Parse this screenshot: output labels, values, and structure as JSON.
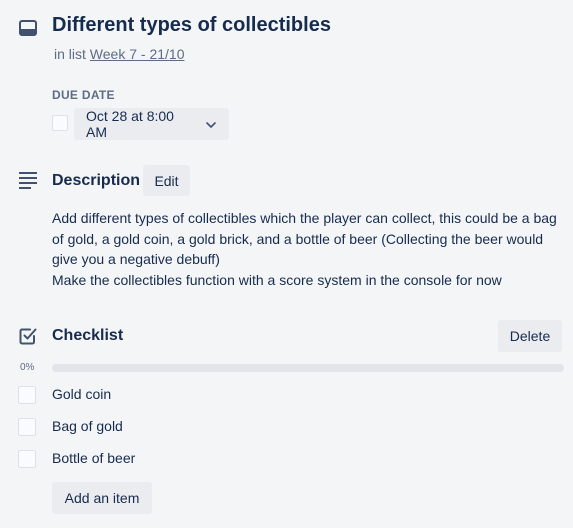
{
  "card": {
    "title": "Different types of collectibles",
    "in_list_prefix": "in list",
    "list_name": "Week 7 - 21/10",
    "icon": "card-icon"
  },
  "due_date": {
    "label": "DUE DATE",
    "value": "Oct 28 at 8:00 AM",
    "completed": false
  },
  "description": {
    "title": "Description",
    "edit_label": "Edit",
    "icon": "description-icon",
    "lines": [
      "Add different types of collectibles which the player can collect, this could be a bag",
      "of gold, a gold coin, a gold brick, and a bottle of beer (Collecting the beer would",
      "give you a negative debuff)",
      "Make the collectibles function with a score system in the console for now"
    ]
  },
  "checklist": {
    "title": "Checklist",
    "delete_label": "Delete",
    "percent_label": "0%",
    "progress": 0,
    "icon": "checklist-icon",
    "items": [
      {
        "label": "Gold coin",
        "checked": false
      },
      {
        "label": "Bag of gold",
        "checked": false
      },
      {
        "label": "Bottle of beer",
        "checked": false
      }
    ],
    "add_item_label": "Add an item"
  },
  "colors": {
    "background": "#f4f5f7",
    "text": "#172b4d",
    "muted": "#5e6c84",
    "button_bg": "#ebecf0",
    "progress_track": "#e2e4e9"
  }
}
